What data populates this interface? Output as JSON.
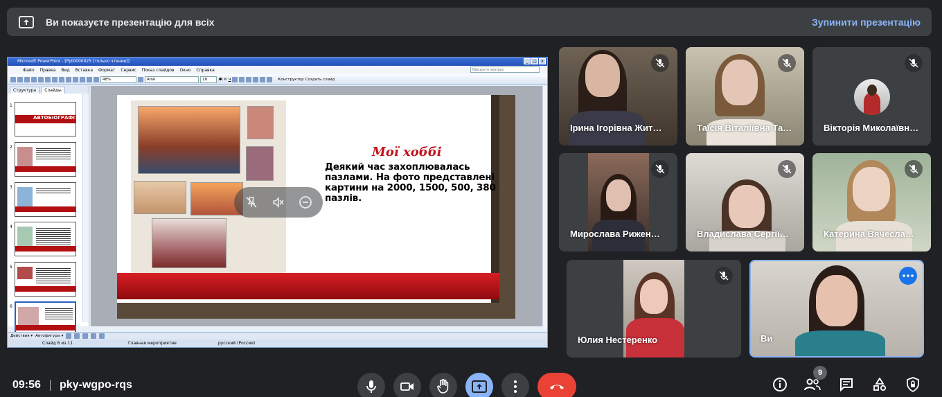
{
  "banner": {
    "message": "Ви показуєте презентацію для всіх",
    "stop_label": "Зупинити презентацію"
  },
  "ppt": {
    "window_title": "Microsoft PowerPoint - [Ppt0000025 [только чтение]]",
    "menu": [
      "Файл",
      "Правка",
      "Вид",
      "Вставка",
      "Формат",
      "Сервис",
      "Показ слайдов",
      "Окно",
      "Справка"
    ],
    "ask_placeholder": "Введите вопрос",
    "zoom": "48%",
    "font": "Arial",
    "font_size": "18",
    "designer_label": "Конструктор",
    "new_slide_label": "Создать слайд",
    "tabs": [
      "Структура",
      "Слайды"
    ],
    "thumb_numbers": [
      "1",
      "2",
      "3",
      "4",
      "5",
      "6"
    ],
    "thumb1_title": "АВТОБІОГРАФІЯ",
    "drawbar": [
      "Действия ▾",
      "Автофигуры ▾"
    ],
    "status": [
      "Слайд 6 из 11",
      "Главная мероприятие",
      "русский (Россия)"
    ],
    "slide": {
      "title": "Мої хоббі",
      "text": "Деякий час захоплювалась пазлами.  На фото представлені картини на 2000, 1500, 500, 380 пазлів."
    }
  },
  "participants": [
    {
      "name": "Ірина Ігорівна Жит…",
      "muted": true
    },
    {
      "name": "Таїсія Віталіївна Та…",
      "muted": true
    },
    {
      "name": "Вікторія Миколаївн…",
      "muted": true
    },
    {
      "name": "Мирослава Рижен…",
      "muted": true
    },
    {
      "name": "Владислава Сергії…",
      "muted": true
    },
    {
      "name": "Катерина Вячесла…",
      "muted": true
    },
    {
      "name": "Юлия Нестеренко",
      "muted": true
    },
    {
      "name": "Ви",
      "muted": false
    }
  ],
  "bottom": {
    "time": "09:56",
    "meeting_code": "pky-wgpo-rqs",
    "participant_count": "9"
  },
  "icons": {
    "banner": "present-to-all-icon",
    "mic": "mic-icon",
    "camera": "camera-icon",
    "hand": "raise-hand-icon",
    "present": "present-icon",
    "more": "more-vert-icon",
    "hangup": "hangup-icon",
    "info": "info-icon",
    "people": "people-icon",
    "chat": "chat-icon",
    "activities": "activities-icon",
    "host": "host-controls-icon"
  },
  "colors": {
    "accent": "#8ab4f8",
    "end_call": "#ea4335",
    "background": "#202124",
    "surface": "#3c4043"
  }
}
